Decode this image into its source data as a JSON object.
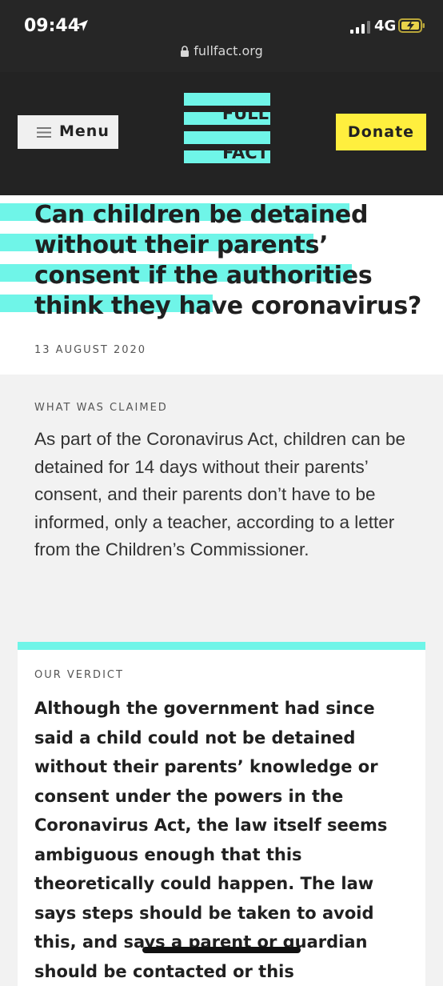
{
  "status_bar": {
    "time": "09:44",
    "network": "4G",
    "url": "fullfact.org"
  },
  "header": {
    "menu_label": "Menu",
    "logo_lines": [
      "FULL",
      "FACT"
    ],
    "donate_label": "Donate",
    "accent_color": "#6ff5e8",
    "donate_color": "#ffef3e"
  },
  "article": {
    "title": "Can children be detained without their parents’ consent if the authorities think they have coronavirus?",
    "date": "13 AUGUST 2020"
  },
  "claim": {
    "label": "WHAT WAS CLAIMED",
    "text": "As part of the Coronavirus Act, children can be detained for 14 days without their parents’ consent, and their parents don’t have to be informed, only a teacher, according to a letter from the Children’s Commissioner."
  },
  "verdict": {
    "label": "OUR VERDICT",
    "text": "Although the government had since said a child could not be detained without their parents’ knowledge or consent under the powers in the Coronavirus Act, the law itself seems ambiguous enough that this theoretically could happen. The law says steps should be taken to avoid this, and says a parent or guardian should be contacted or this"
  }
}
